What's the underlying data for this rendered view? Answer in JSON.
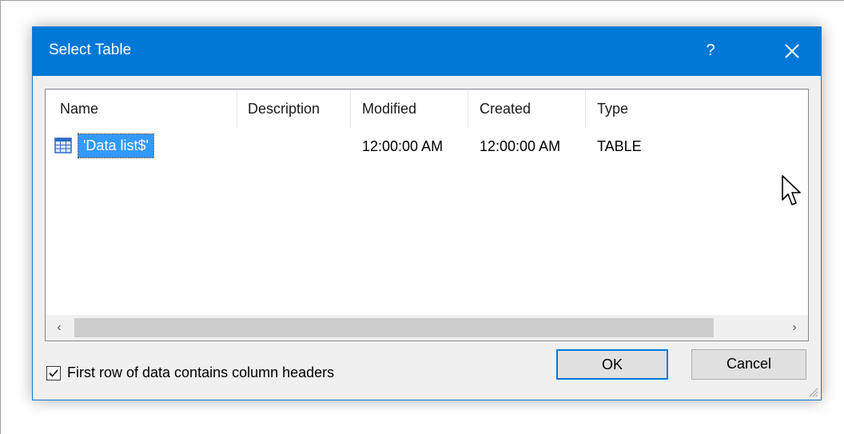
{
  "dialog": {
    "title": "Select Table",
    "help_label": "?"
  },
  "list": {
    "columns": [
      "Name",
      "Description",
      "Modified",
      "Created",
      "Type"
    ],
    "rows": [
      {
        "name": "'Data list$'",
        "description": "",
        "modified": "12:00:00 AM",
        "created": "12:00:00 AM",
        "type": "TABLE"
      }
    ]
  },
  "scrollbar": {
    "left_arrow": "‹",
    "right_arrow": "›"
  },
  "options": {
    "first_row_headers_label": "First row of data contains column headers",
    "first_row_headers_checked": true
  },
  "buttons": {
    "ok_label": "OK",
    "cancel_label": "Cancel"
  },
  "colors": {
    "titlebar": "#0078d7",
    "selection": "#3399ff",
    "dialog_bg": "#f0f0f0"
  },
  "icons": {
    "help": "question-mark-icon",
    "close": "close-icon",
    "table": "table-icon",
    "cursor": "mouse-pointer-icon",
    "grip": "resize-grip-icon",
    "check": "checkmark-icon"
  }
}
